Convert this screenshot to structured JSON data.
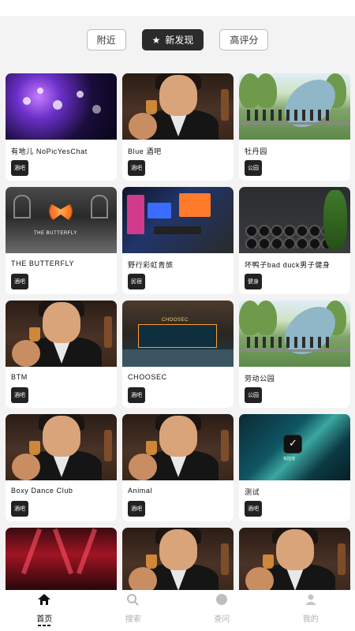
{
  "filters": [
    {
      "label": "附近",
      "active": false
    },
    {
      "label": "新发现",
      "active": true,
      "icon": "star-icon"
    },
    {
      "label": "高评分",
      "active": false
    }
  ],
  "venues": [
    {
      "title": "有地儿 NoPicYesChat",
      "tag": "酒吧",
      "thumb": "party"
    },
    {
      "title": "Blue 酒吧",
      "tag": "酒吧",
      "thumb": "anime"
    },
    {
      "title": "牡丹园",
      "tag": "公园",
      "thumb": "park"
    },
    {
      "title": "THE BUTTERFLY",
      "tag": "酒吧",
      "thumb": "butterfly",
      "sign": "THE BUTTERFLY"
    },
    {
      "title": "野行彩虹青旅",
      "tag": "民宿",
      "thumb": "hostel"
    },
    {
      "title": "坏鸭子bad duck男子健身",
      "tag": "健身",
      "thumb": "gym"
    },
    {
      "title": "BTM",
      "tag": "酒吧",
      "thumb": "anime"
    },
    {
      "title": "CHOOSEC",
      "tag": "酒吧",
      "thumb": "choose",
      "sign": "CHOOSEC"
    },
    {
      "title": "劳动公园",
      "tag": "公园",
      "thumb": "park"
    },
    {
      "title": "Boxy Dance Club",
      "tag": "酒吧",
      "thumb": "anime"
    },
    {
      "title": "Animal",
      "tag": "酒吧",
      "thumb": "anime"
    },
    {
      "title": "测试",
      "tag": "酒吧",
      "thumb": "test",
      "sign": "有陆地"
    },
    {
      "title": "",
      "tag": "",
      "thumb": "club"
    },
    {
      "title": "",
      "tag": "",
      "thumb": "anime"
    },
    {
      "title": "",
      "tag": "",
      "thumb": "anime"
    }
  ],
  "tabbar": [
    {
      "label": "首页",
      "icon": "home-icon",
      "active": true
    },
    {
      "label": "搜索",
      "icon": "search-icon",
      "active": false
    },
    {
      "label": "查问",
      "icon": "circle-icon",
      "active": false
    },
    {
      "label": "我的",
      "icon": "user-icon",
      "active": false
    }
  ],
  "colors": {
    "accent": "#2b2b2b",
    "background": "#f3f3f3",
    "tag_bg": "#222222"
  }
}
